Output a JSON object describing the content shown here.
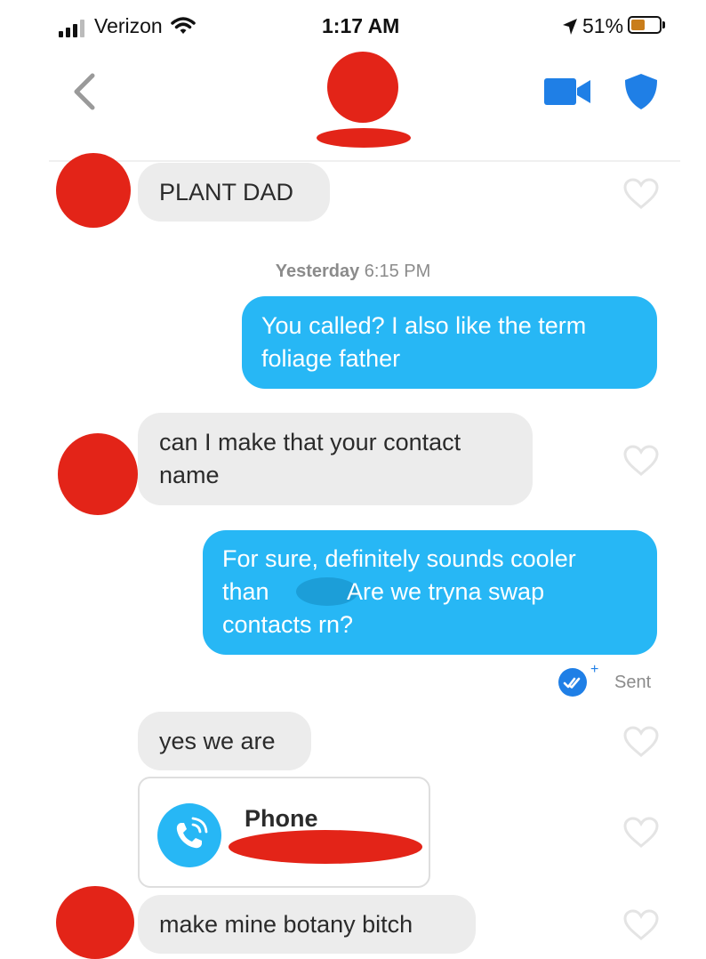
{
  "status_bar": {
    "carrier": "Verizon",
    "time": "1:17 AM",
    "battery_percent": "51%",
    "battery_level": 0.51
  },
  "header": {
    "back_icon": "chevron-left-icon",
    "video_icon": "video-camera-icon",
    "safety_icon": "shield-icon",
    "accent_color": "#1f7fe6"
  },
  "thread": {
    "date_separator": {
      "day": "Yesterday",
      "time": "6:15 PM"
    },
    "messages": [
      {
        "from": "them",
        "text": "PLANT DAD"
      },
      {
        "from": "me",
        "lines": [
          "You called? I also like the term",
          "foliage father"
        ]
      },
      {
        "from": "them",
        "lines": [
          "can I make that your contact",
          "name"
        ]
      },
      {
        "from": "me",
        "lines": [
          "For sure, definitely sounds cooler",
          "than",
          "Are we tryna swap",
          "contacts rn?"
        ]
      },
      {
        "from": "them",
        "text": "yes we are"
      },
      {
        "from": "them",
        "type": "contact-card",
        "label": "Phone"
      },
      {
        "from": "them",
        "text": "make mine botany bitch"
      }
    ],
    "read_receipt": {
      "status": "Sent",
      "icon": "double-check-icon"
    }
  },
  "colors": {
    "outgoing_bubble": "#27b7f5",
    "incoming_bubble": "#ececec",
    "redaction": "#e32418",
    "redaction_blue": "#1c9ed8"
  }
}
